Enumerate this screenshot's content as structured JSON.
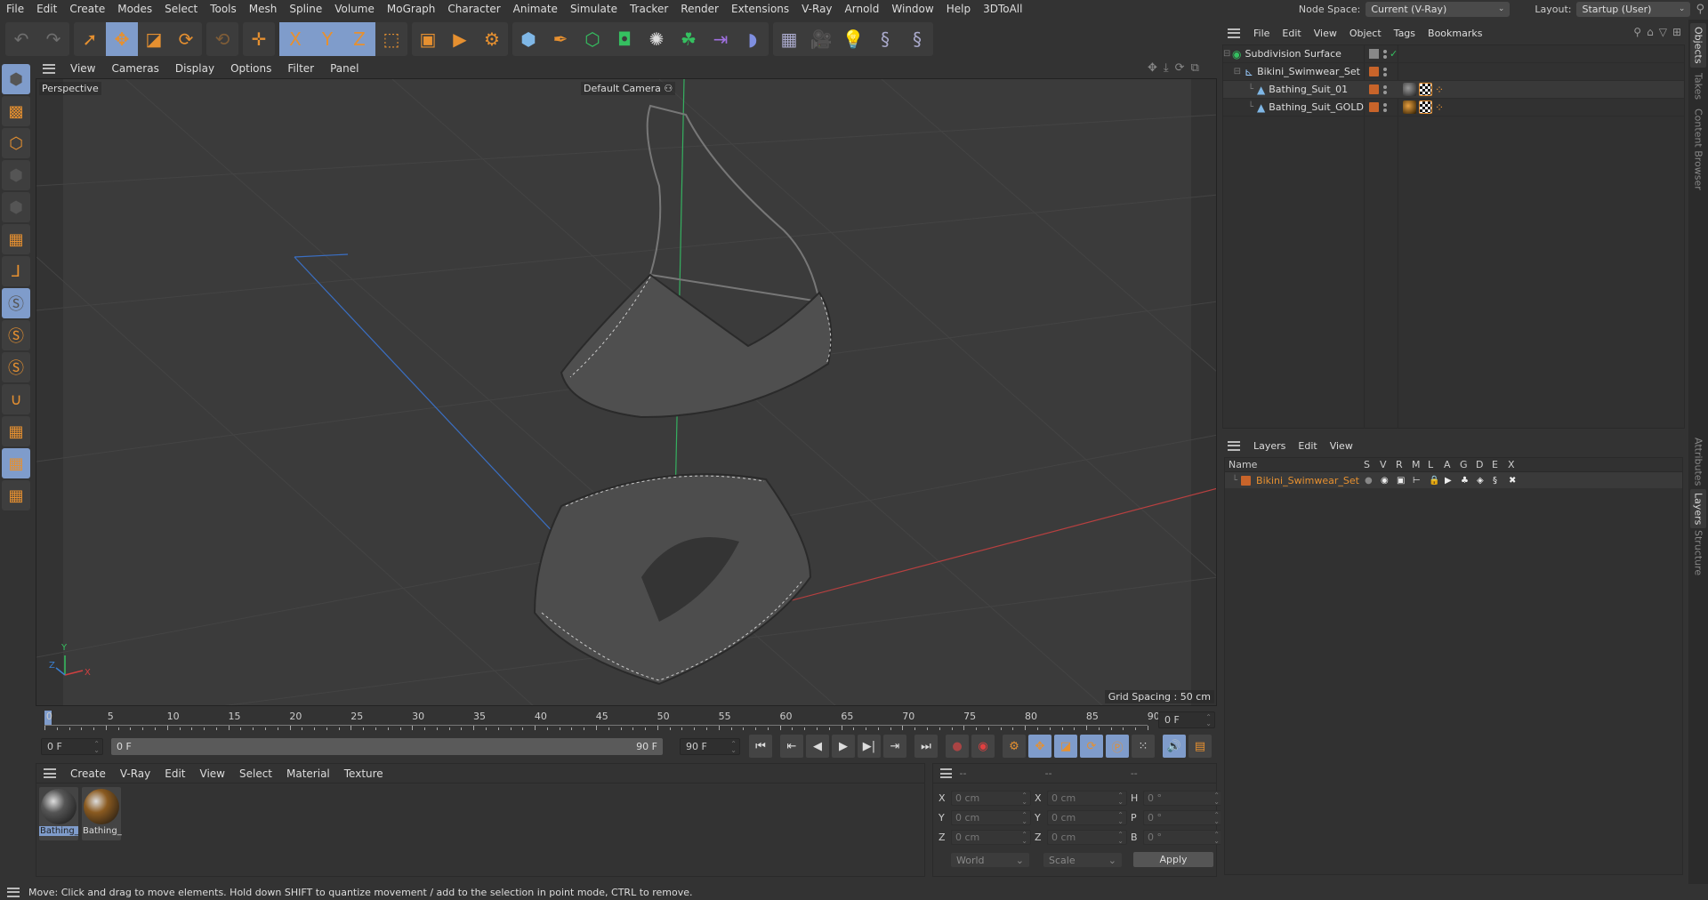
{
  "menubar": {
    "items": [
      "File",
      "Edit",
      "Create",
      "Modes",
      "Select",
      "Tools",
      "Mesh",
      "Spline",
      "Volume",
      "MoGraph",
      "Character",
      "Animate",
      "Simulate",
      "Tracker",
      "Render",
      "Extensions",
      "V-Ray",
      "Arnold",
      "Window",
      "Help",
      "3DToAll"
    ],
    "node_space_label": "Node Space:",
    "node_space_value": "Current (V-Ray)",
    "layout_label": "Layout:",
    "layout_value": "Startup (User)"
  },
  "toolbar": {
    "buttons": [
      {
        "name": "undo",
        "glyph": "↶"
      },
      {
        "name": "redo",
        "glyph": "↷"
      },
      {
        "name": "live-selection",
        "glyph": "➚"
      },
      {
        "name": "move",
        "glyph": "✥"
      },
      {
        "name": "scale",
        "glyph": "◪"
      },
      {
        "name": "rotate",
        "glyph": "⟳"
      },
      {
        "name": "psr",
        "glyph": "⟲"
      },
      {
        "name": "add-object",
        "glyph": "✛"
      },
      {
        "name": "x-axis",
        "glyph": "X"
      },
      {
        "name": "y-axis",
        "glyph": "Y"
      },
      {
        "name": "z-axis",
        "glyph": "Z"
      },
      {
        "name": "coordinate-system",
        "glyph": "⬚"
      },
      {
        "name": "render-view",
        "glyph": "▣"
      },
      {
        "name": "render-picture-viewer",
        "glyph": "▶"
      },
      {
        "name": "render-settings",
        "glyph": "⚙"
      },
      {
        "name": "cube",
        "glyph": "⬢"
      },
      {
        "name": "pen",
        "glyph": "✒"
      },
      {
        "name": "subdivision",
        "glyph": "⬡"
      },
      {
        "name": "extrude",
        "glyph": "◘"
      },
      {
        "name": "mograph-cloner",
        "glyph": "✺"
      },
      {
        "name": "array",
        "glyph": "☘"
      },
      {
        "name": "deformer",
        "glyph": "⇥"
      },
      {
        "name": "field",
        "glyph": "◗"
      },
      {
        "name": "floor",
        "glyph": "▦"
      },
      {
        "name": "camera",
        "glyph": "🎥"
      },
      {
        "name": "light",
        "glyph": "💡"
      },
      {
        "name": "python-1",
        "glyph": "§"
      },
      {
        "name": "python-2",
        "glyph": "§"
      }
    ]
  },
  "left_tools": [
    "model-mode",
    "texture-mode",
    "points-mode",
    "edges-mode",
    "polygons-mode",
    "uv-mode",
    "axis-mode",
    "solo-off",
    "solo",
    "solo-hierarchy",
    "snap",
    "workplane",
    "locked-workplane",
    "workplane-cycle"
  ],
  "viewport": {
    "menu": [
      "View",
      "Cameras",
      "Display",
      "Options",
      "Filter",
      "Panel"
    ],
    "label": "Perspective",
    "camera": "Default Camera",
    "grid_spacing": "Grid Spacing : 50 cm",
    "axis_labels": {
      "x": "X",
      "y": "Y",
      "z": "Z"
    }
  },
  "timeline": {
    "ticks": [
      "0",
      "5",
      "10",
      "15",
      "20",
      "25",
      "30",
      "35",
      "40",
      "45",
      "50",
      "55",
      "60",
      "65",
      "70",
      "75",
      "80",
      "85",
      "90"
    ],
    "current_frame_right": "0 F",
    "start_frame": "0 F",
    "range_start": "0 F",
    "range_end": "90 F",
    "end_frame": "90 F",
    "current_frame_fraction": 0
  },
  "materials": {
    "menu": [
      "Create",
      "V-Ray",
      "Edit",
      "View",
      "Select",
      "Material",
      "Texture"
    ],
    "items": [
      {
        "name": "Bathing_",
        "color": "#555555",
        "selected": true
      },
      {
        "name": "Bathing_",
        "color": "#8a5a20",
        "selected": false
      }
    ]
  },
  "coordinates": {
    "headers": [
      "--",
      "--",
      "--"
    ],
    "rows": [
      {
        "l1": "X",
        "v1": "0 cm",
        "l2": "X",
        "v2": "0 cm",
        "l3": "H",
        "v3": "0 °"
      },
      {
        "l1": "Y",
        "v1": "0 cm",
        "l2": "Y",
        "v2": "0 cm",
        "l3": "P",
        "v3": "0 °"
      },
      {
        "l1": "Z",
        "v1": "0 cm",
        "l2": "Z",
        "v2": "0 cm",
        "l3": "B",
        "v3": "0 °"
      }
    ],
    "space": "World",
    "mode": "Scale",
    "apply": "Apply"
  },
  "object_manager": {
    "menu": [
      "File",
      "Edit",
      "View",
      "Object",
      "Tags",
      "Bookmarks"
    ],
    "objects": [
      {
        "name": "Subdivision Surface",
        "indent": 0,
        "type": "subdivision"
      },
      {
        "name": "Bikini_Swimwear_Set",
        "indent": 1,
        "type": "null"
      },
      {
        "name": "Bathing_Suit_01",
        "indent": 2,
        "type": "polygon"
      },
      {
        "name": "Bathing_Suit_GOLD",
        "indent": 2,
        "type": "polygon"
      }
    ]
  },
  "layers": {
    "menu": [
      "Layers",
      "Edit",
      "View"
    ],
    "columns": [
      "Name",
      "S",
      "V",
      "R",
      "M",
      "L",
      "A",
      "G",
      "D",
      "E",
      "X"
    ],
    "rows": [
      {
        "name": "Bikini_Swimwear_Set",
        "color": "#c8642a"
      }
    ]
  },
  "side_tabs": {
    "top": [
      "Objects",
      "Takes",
      "Content Browser"
    ],
    "bottom": [
      "Attributes",
      "Layers",
      "Structure"
    ]
  },
  "status": "Move: Click and drag to move elements. Hold down SHIFT to quantize movement / add to the selection in point mode, CTRL to remove.",
  "colors": {
    "accent": "#7f9ccb",
    "orange": "#e69030",
    "layer": "#c8642a"
  }
}
